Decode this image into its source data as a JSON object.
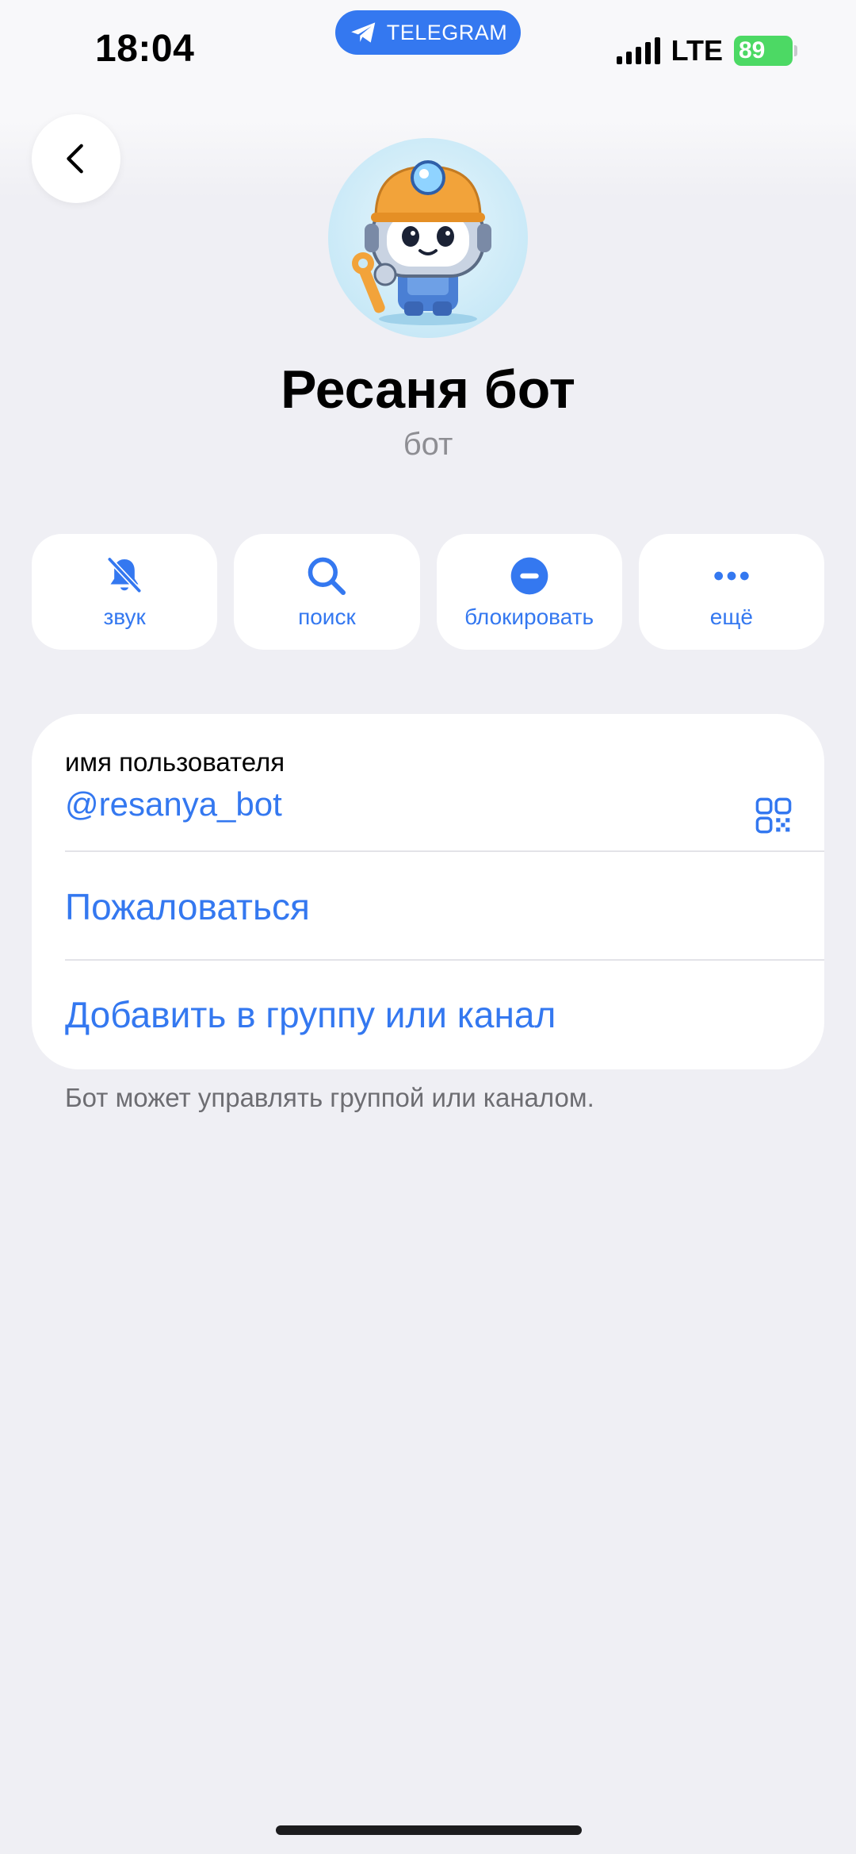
{
  "status": {
    "time": "18:04",
    "app_label": "TELEGRAM",
    "network": "LTE",
    "battery": "89"
  },
  "profile": {
    "name": "Ресаня бот",
    "subtitle": "бот"
  },
  "actions": [
    {
      "label": "звук",
      "icon": "bell-slash-icon"
    },
    {
      "label": "поиск",
      "icon": "search-icon"
    },
    {
      "label": "блокировать",
      "icon": "block-icon"
    },
    {
      "label": "ещё",
      "icon": "more-icon"
    }
  ],
  "info": {
    "username_label": "имя пользователя",
    "username_value": "@resanya_bot",
    "report": "Пожаловаться",
    "add_to_group": "Добавить в группу или канал"
  },
  "hint": "Бот может управлять группой или каналом.",
  "colors": {
    "accent": "#3478f0",
    "background": "#efeff4",
    "battery": "#4cd964"
  }
}
